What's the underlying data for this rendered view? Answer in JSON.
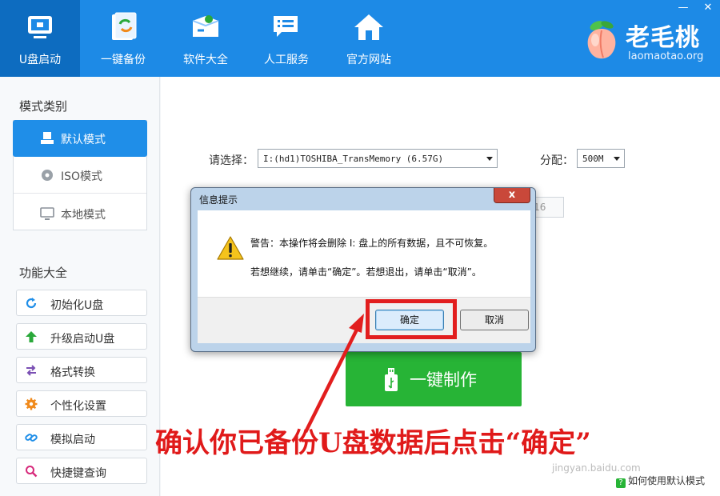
{
  "window": {
    "minimize_label": "—",
    "close_label": "✕"
  },
  "nav": {
    "items": [
      {
        "label": "U盘启动",
        "icon": "usb-monitor-icon",
        "active": true
      },
      {
        "label": "一键备份",
        "icon": "backup-refresh-icon",
        "active": false
      },
      {
        "label": "软件大全",
        "icon": "software-box-icon",
        "active": false
      },
      {
        "label": "人工服务",
        "icon": "chat-service-icon",
        "active": false
      },
      {
        "label": "官方网站",
        "icon": "home-icon",
        "active": false
      }
    ]
  },
  "brand": {
    "name": "老毛桃",
    "url": "laomaotao.org",
    "logo_icon": "peach-logo-icon"
  },
  "sidebar": {
    "mode_title": "模式类别",
    "modes": [
      {
        "label": "默认模式",
        "icon": "default-mode-icon",
        "active": true
      },
      {
        "label": "ISO模式",
        "icon": "disc-icon",
        "active": false
      },
      {
        "label": "本地模式",
        "icon": "monitor-icon",
        "active": false
      }
    ],
    "func_title": "功能大全",
    "functions": [
      {
        "label": "初始化U盘",
        "icon": "refresh-icon",
        "color": "#1f8ee8"
      },
      {
        "label": "升级启动U盘",
        "icon": "arrow-up-icon",
        "color": "#2aa83a"
      },
      {
        "label": "格式转换",
        "icon": "swap-icon",
        "color": "#7a4fb3"
      },
      {
        "label": "个性化设置",
        "icon": "gear-icon",
        "color": "#f08a1c"
      },
      {
        "label": "模拟启动",
        "icon": "link-icon",
        "color": "#1f8ee8"
      },
      {
        "label": "快捷键查询",
        "icon": "search-icon",
        "color": "#d6287a"
      }
    ]
  },
  "main": {
    "select_label": "请选择：",
    "device_value": "I:(hd1)TOSHIBA_TransMemory (6.57G)",
    "alloc_label": "分配：",
    "alloc_value": "500M",
    "ghost_fs": "AT16",
    "make_button": "一键制作",
    "make_icon": "usb-stick-icon",
    "help_link": "如何使用默认模式",
    "help_icon": "question-icon"
  },
  "dialog": {
    "title": "信息提示",
    "close": "x",
    "icon": "warning-icon",
    "line1": "警告：本操作将会删除 I: 盘上的所有数据，且不可恢复。",
    "line2": "若想继续，请单击“确定”。若想退出，请单击“取消”。",
    "ok": "确定",
    "cancel": "取消"
  },
  "annotation": {
    "caption": "确认你已备份U盘数据后点击“确定”",
    "color": "#e01a1a"
  },
  "watermark": "jingyan.baidu.com",
  "colors": {
    "topbar": "#1d8ae6",
    "active_blue": "#1f8ee8",
    "make_green": "#27b436"
  }
}
